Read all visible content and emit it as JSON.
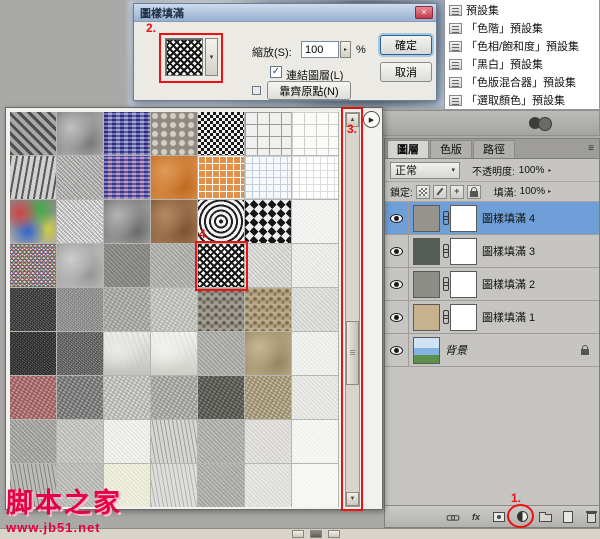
{
  "colors": {
    "annotation_red": "#ee1111",
    "selection_blue": "#6f9fd8",
    "watermark_red": "#e50043",
    "watermark_pink": "#f9b8cf"
  },
  "icons": {
    "close": "×",
    "dropdown": "▾",
    "spinner": "▸",
    "scrubby": "▸",
    "flyout": "▶",
    "scroll_up": "▲",
    "scroll_down": "▼",
    "panel_menu": "≡",
    "check": "✓",
    "fx": "fx"
  },
  "annotations": {
    "step1": "1.",
    "step2": "2.",
    "step3": "3.",
    "step4": "4."
  },
  "dialog": {
    "title": "圖樣填滿",
    "scale_label": "縮放(S):",
    "scale_value": "100",
    "percent": "%",
    "ok_label": "確定",
    "cancel_label": "取消",
    "link_label": "連結圖層(L)",
    "snap_label": "靠齊原點(N)",
    "pattern": {
      "s": "herringbone",
      "a": "#161616",
      "b": "#f8f8f4"
    }
  },
  "preset_menu": {
    "items": [
      {
        "label": "預設集"
      },
      {
        "label": "「色階」預設集"
      },
      {
        "label": "「色相/飽和度」預設集"
      },
      {
        "label": "「黑白」預設集"
      },
      {
        "label": "「色版混合器」預設集"
      },
      {
        "label": "「選取顏色」預設集"
      }
    ]
  },
  "layers_panel": {
    "tabs": [
      "圖層",
      "色版",
      "路徑"
    ],
    "blend_mode": "正常",
    "opacity_label": "不透明度:",
    "opacity_value": "100%",
    "lock_label": "鎖定:",
    "fill_label": "填滿:",
    "fill_value": "100%",
    "layers": [
      {
        "name": "圖樣填滿 4",
        "selected": true,
        "thumb": "#96928c"
      },
      {
        "name": "圖樣填滿 3",
        "thumb": "#535d55"
      },
      {
        "name": "圖樣填滿 2",
        "thumb": "#8e8e88"
      },
      {
        "name": "圖樣填滿 1",
        "thumb": "#c8b28e"
      },
      {
        "name": "背景",
        "background": true,
        "locked": true,
        "thumb_style": "landscape"
      }
    ]
  },
  "watermark": {
    "line1": "脚本之家",
    "line2": "www.jb51.net"
  },
  "pattern_grid": {
    "columns": 7,
    "cells": [
      {
        "s": "stripes",
        "a": "#4e4e4e",
        "b": "#a8a8a8"
      },
      {
        "s": "plasma",
        "a": "#7a7a7a",
        "b": "#c0c0c0"
      },
      {
        "s": "weave",
        "a": "#3b3b9e",
        "b": "#7d7dc8"
      },
      {
        "s": "dots",
        "a": "#8f8a80",
        "b": "#d5d0c6"
      },
      {
        "s": "checker",
        "a": "#1a1a1a",
        "b": "#ededed"
      },
      {
        "s": "tiles",
        "a": "#f0f0ee",
        "b": "#9a9a98"
      },
      {
        "s": "tiles",
        "a": "#fbfbfa",
        "b": "#cfcfcd"
      },
      {
        "s": "stripesH",
        "a": "#5a5a5a",
        "b": "#d0d0d0"
      },
      {
        "s": "noise",
        "a": "#808080",
        "b": "#d8d8d6"
      },
      {
        "s": "weave",
        "a": "#4a4ab4",
        "b": "#9a72b4"
      },
      {
        "s": "plasma",
        "a": "#c06a20",
        "b": "#e09a58"
      },
      {
        "s": "grid",
        "a": "#e2914a",
        "b": "#ffffff"
      },
      {
        "s": "grid",
        "a": "#f6f8fa",
        "b": "#c2cedd"
      },
      {
        "s": "grid",
        "a": "#ffffff",
        "b": "#dddddd"
      },
      {
        "s": "rainbow",
        "a": "#888888",
        "b": "#aaaaaa"
      },
      {
        "s": "noise",
        "a": "#ffffff",
        "b": "#9a9a9a"
      },
      {
        "s": "plasma",
        "a": "#6a6a6a",
        "b": "#b4b4b4"
      },
      {
        "s": "plasma",
        "a": "#7e5232",
        "b": "#b48a62"
      },
      {
        "s": "rings",
        "a": "#202020",
        "b": "#f4f4f4"
      },
      {
        "s": "zigzag",
        "a": "#161616",
        "b": "#efefef"
      },
      {
        "s": "noise",
        "a": "#e6e6e4",
        "b": "#fbfbfa"
      },
      {
        "s": "rgb",
        "a": "#b43232",
        "b": "#3264b4"
      },
      {
        "s": "plasma",
        "a": "#969696",
        "b": "#cccccc"
      },
      {
        "s": "noise",
        "a": "#6e6e6a",
        "b": "#a2a29e"
      },
      {
        "s": "noise",
        "a": "#8e8e8a",
        "b": "#cccac6"
      },
      {
        "s": "herringbone",
        "a": "#161616",
        "b": "#f8f8f4"
      },
      {
        "s": "noise",
        "a": "#b8b8b4",
        "b": "#eeeeec"
      },
      {
        "s": "noise",
        "a": "#dcdcda",
        "b": "#f6f6f4"
      },
      {
        "s": "speckle",
        "a": "#2e2e2e",
        "b": "#6e6e6e"
      },
      {
        "s": "speckle",
        "a": "#7e7e7e",
        "b": "#b2b2b0"
      },
      {
        "s": "granite",
        "a": "#8e8e8a",
        "b": "#c2c2be"
      },
      {
        "s": "granite",
        "a": "#aaaaa6",
        "b": "#d8d8d4"
      },
      {
        "s": "gravel",
        "a": "#5e5a52",
        "b": "#a49e92"
      },
      {
        "s": "gravel",
        "a": "#7e6f52",
        "b": "#bcab88"
      },
      {
        "s": "noise",
        "a": "#c6c6c2",
        "b": "#ebebe9"
      },
      {
        "s": "speckle",
        "a": "#262626",
        "b": "#606060"
      },
      {
        "s": "speckle",
        "a": "#4e4e4e",
        "b": "#949494"
      },
      {
        "s": "marble",
        "a": "#c2c2be",
        "b": "#ebebe7"
      },
      {
        "s": "marble",
        "a": "#cfcfc9",
        "b": "#f2f2ee"
      },
      {
        "s": "noise",
        "a": "#8e8e8a",
        "b": "#c6c6c2"
      },
      {
        "s": "plasma",
        "a": "#96855f",
        "b": "#c6b694"
      },
      {
        "s": "noise",
        "a": "#e2e2de",
        "b": "#f8f8f6"
      },
      {
        "s": "granite",
        "a": "#8a4e4e",
        "b": "#cc9494"
      },
      {
        "s": "granite",
        "a": "#5e5e5e",
        "b": "#a2a2a2"
      },
      {
        "s": "granite",
        "a": "#a2a29e",
        "b": "#dcdcd8"
      },
      {
        "s": "granite",
        "a": "#8a8a86",
        "b": "#c6c6c2"
      },
      {
        "s": "granite",
        "a": "#44443f",
        "b": "#7e7e78"
      },
      {
        "s": "granite",
        "a": "#8a7e62",
        "b": "#c6bc9e"
      },
      {
        "s": "noise",
        "a": "#d6d6d2",
        "b": "#f2f2f0"
      },
      {
        "s": "noise",
        "a": "#82827e",
        "b": "#c2c2be"
      },
      {
        "s": "noise",
        "a": "#a6a6a2",
        "b": "#dadad6"
      },
      {
        "s": "noise",
        "a": "#dcdcd8",
        "b": "#fafaf8"
      },
      {
        "s": "streaks",
        "a": "#9e9e9a",
        "b": "#d6d6d2"
      },
      {
        "s": "noise",
        "a": "#92928e",
        "b": "#c9c9c7"
      },
      {
        "s": "noise",
        "a": "#cccac6",
        "b": "#ecebe9"
      },
      {
        "s": "noise",
        "a": "#ebebe9",
        "b": "#fbfbf9"
      },
      {
        "s": "streaks",
        "a": "#82827e",
        "b": "#bcbcb8"
      },
      {
        "s": "noise",
        "a": "#a2a29e",
        "b": "#d2d2ce"
      },
      {
        "s": "noise",
        "a": "#dedeba",
        "b": "#f6f6f4"
      },
      {
        "s": "streaks",
        "a": "#b2b2ae",
        "b": "#dededa"
      },
      {
        "s": "noise",
        "a": "#92928e",
        "b": "#c6c6c2"
      },
      {
        "s": "noise",
        "a": "#d2d2ce",
        "b": "#eeeeec"
      },
      {
        "s": "noise",
        "a": "#f0f0ee",
        "b": "#fcfcfa"
      }
    ]
  }
}
